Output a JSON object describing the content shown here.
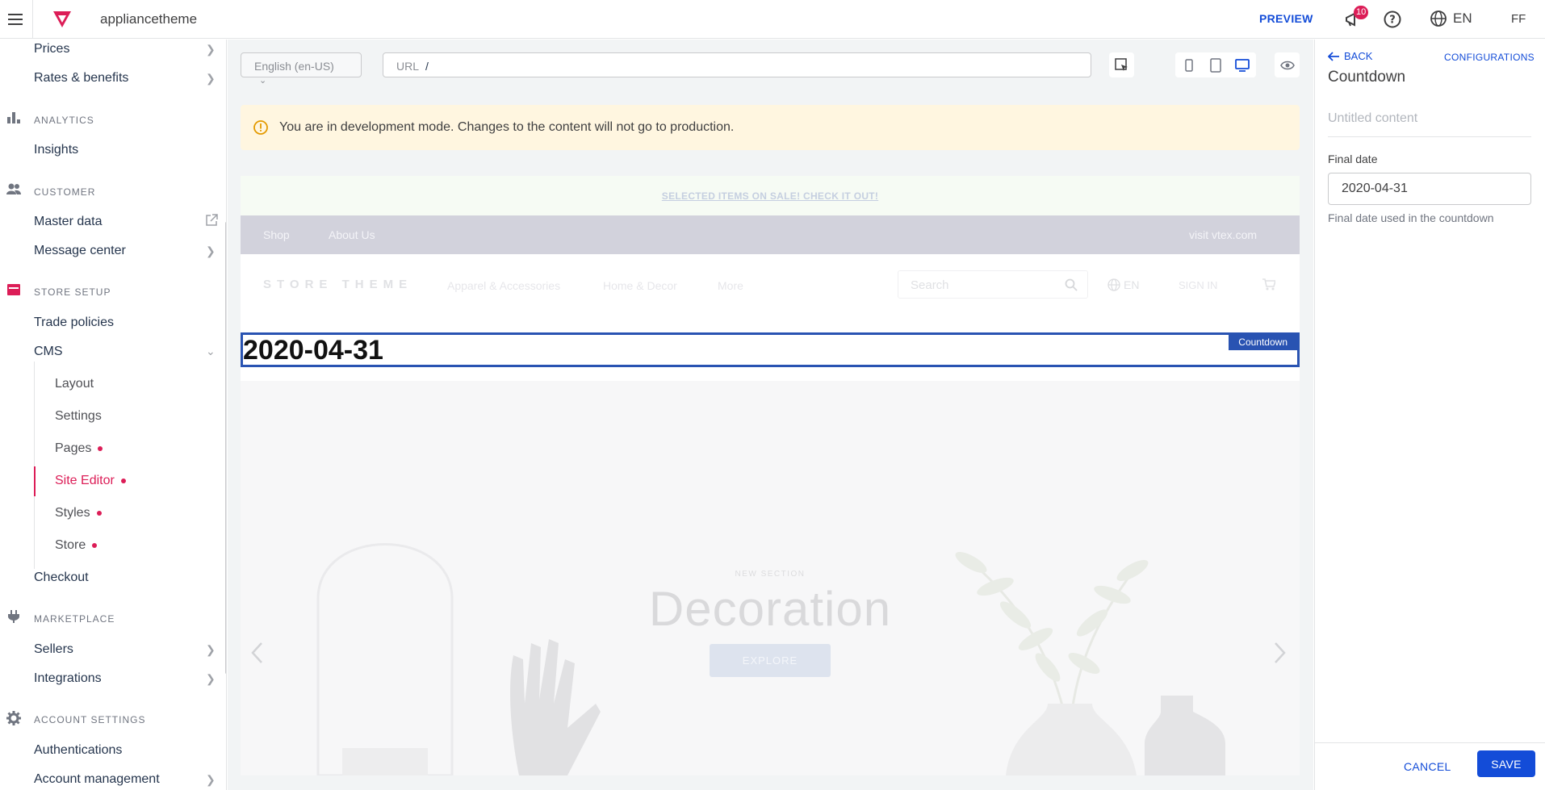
{
  "topbar": {
    "account": "appliancetheme",
    "preview": "PREVIEW",
    "notification_count": "10",
    "language": "EN",
    "user_initials": "FF"
  },
  "sidebar": {
    "items_top": [
      "Prices",
      "Rates & benefits"
    ],
    "analytics": {
      "title": "ANALYTICS",
      "items": [
        "Insights"
      ]
    },
    "customer": {
      "title": "CUSTOMER",
      "items": [
        "Master data",
        "Message center"
      ]
    },
    "store_setup": {
      "title": "STORE SETUP",
      "items": [
        "Trade policies",
        "CMS"
      ]
    },
    "cms_items": [
      "Layout",
      "Settings",
      "Pages",
      "Site Editor",
      "Styles",
      "Store"
    ],
    "after_cms": "Checkout",
    "marketplace": {
      "title": "MARKETPLACE",
      "items": [
        "Sellers",
        "Integrations"
      ]
    },
    "account_settings": {
      "title": "ACCOUNT SETTINGS",
      "items": [
        "Authentications",
        "Account management"
      ]
    },
    "active_item": "Site Editor",
    "accent_color": "#dc1d57"
  },
  "editor": {
    "locale": "English (en-US)",
    "url_label": "URL",
    "url_value": "/",
    "dev_banner": "You are in development mode. Changes to the content will not go to production."
  },
  "store": {
    "promo": "SELECTED ITEMS ON SALE! CHECK IT OUT!",
    "nav": [
      "Shop",
      "About Us"
    ],
    "nav_right": "visit vtex.com",
    "brand": "STORE THEME",
    "categories": [
      "Apparel & Accessories",
      "Home & Decor",
      "More"
    ],
    "search_placeholder": "Search",
    "language": "EN",
    "sign_in": "SIGN IN",
    "countdown_value": "2020-04-31",
    "countdown_tag": "Countdown",
    "hero_kicker": "NEW SECTION",
    "hero_title": "Decoration",
    "hero_button": "EXPLORE"
  },
  "panel": {
    "back": "BACK",
    "configurations": "CONFIGURATIONS",
    "title": "Countdown",
    "content_name_placeholder": "Untitled content",
    "final_date_label": "Final date",
    "final_date_value": "2020-04-31",
    "final_date_help": "Final date used in the countdown",
    "cancel": "CANCEL",
    "save": "SAVE",
    "primary_color": "#134cd8"
  }
}
